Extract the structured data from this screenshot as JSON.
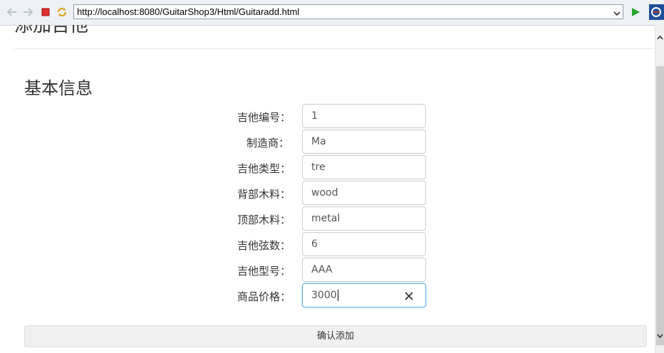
{
  "browser": {
    "url": "http://localhost:8080/GuitarShop3/Html/Guitaradd.html",
    "icons": [
      "back-icon",
      "forward-icon",
      "stop-icon",
      "refresh-icon",
      "dropdown-icon",
      "go-icon",
      "extension-icon"
    ]
  },
  "page": {
    "heading": "添加吉他",
    "section_title": "基本信息"
  },
  "form": {
    "fields": [
      {
        "label": "吉他编号：",
        "value": "1"
      },
      {
        "label": "制造商：",
        "value": "Ma"
      },
      {
        "label": "吉他类型：",
        "value": "tre"
      },
      {
        "label": "背部木料：",
        "value": "wood"
      },
      {
        "label": "顶部木料：",
        "value": "metal"
      },
      {
        "label": "吉他弦数：",
        "value": "6"
      },
      {
        "label": "吉他型号：",
        "value": "AAA"
      },
      {
        "label": "商品价格：",
        "value": "3000"
      }
    ],
    "submit_label": "确认添加"
  }
}
